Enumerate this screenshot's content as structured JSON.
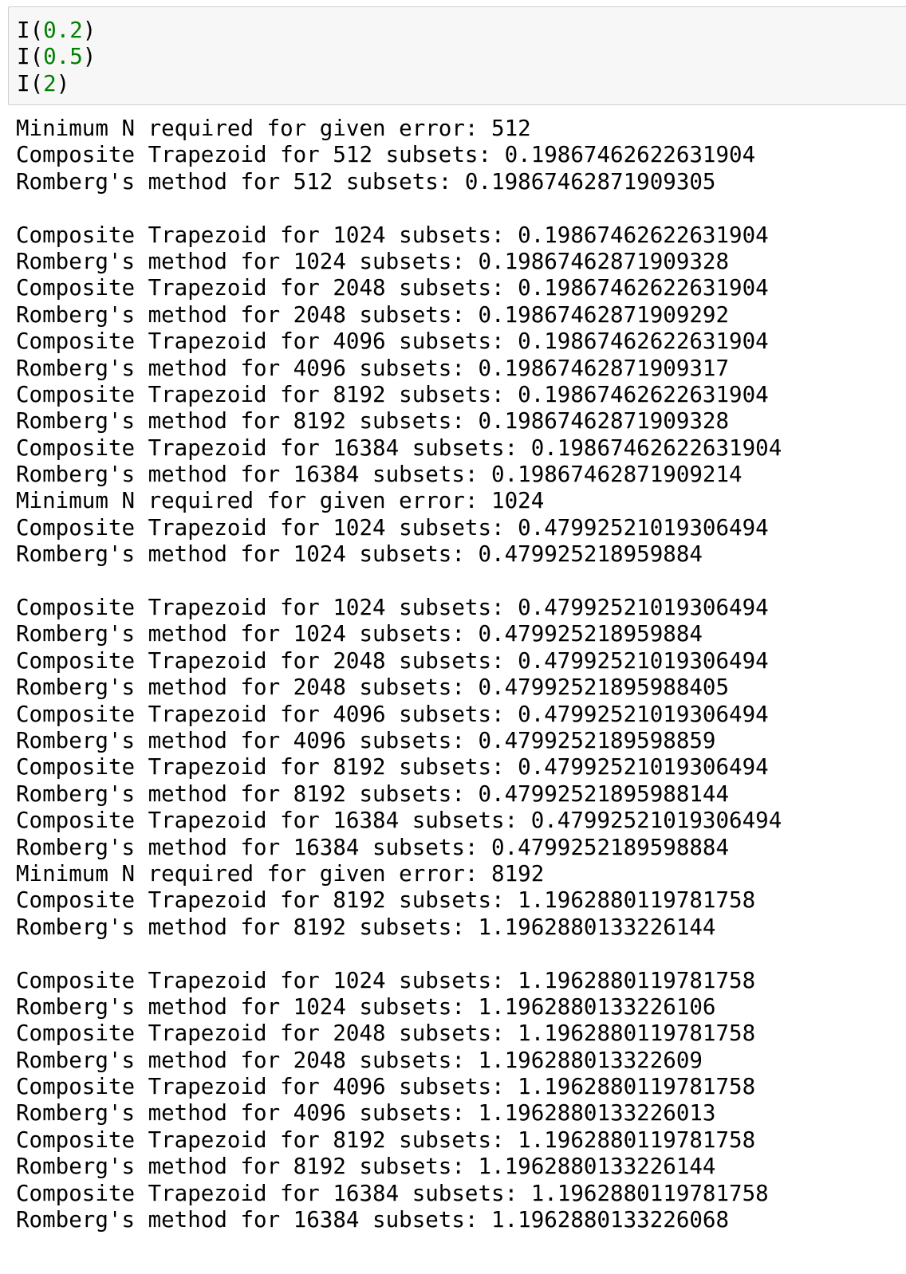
{
  "input_cell": {
    "lines": [
      {
        "func": "I",
        "open": "(",
        "arg": "0.2",
        "close": ")"
      },
      {
        "func": "I",
        "open": "(",
        "arg": "0.5",
        "close": ")"
      },
      {
        "func": "I",
        "open": "(",
        "arg": "2",
        "close": ")"
      }
    ]
  },
  "output": {
    "lines": [
      "Minimum N required for given error: 512",
      "Composite Trapezoid for 512 subsets: 0.19867462622631904",
      "Romberg's method for 512 subsets: 0.19867462871909305",
      "",
      "Composite Trapezoid for 1024 subsets: 0.19867462622631904",
      "Romberg's method for 1024 subsets: 0.19867462871909328",
      "Composite Trapezoid for 2048 subsets: 0.19867462622631904",
      "Romberg's method for 2048 subsets: 0.19867462871909292",
      "Composite Trapezoid for 4096 subsets: 0.19867462622631904",
      "Romberg's method for 4096 subsets: 0.19867462871909317",
      "Composite Trapezoid for 8192 subsets: 0.19867462622631904",
      "Romberg's method for 8192 subsets: 0.19867462871909328",
      "Composite Trapezoid for 16384 subsets: 0.19867462622631904",
      "Romberg's method for 16384 subsets: 0.19867462871909214",
      "Minimum N required for given error: 1024",
      "Composite Trapezoid for 1024 subsets: 0.47992521019306494",
      "Romberg's method for 1024 subsets: 0.479925218959884",
      "",
      "Composite Trapezoid for 1024 subsets: 0.47992521019306494",
      "Romberg's method for 1024 subsets: 0.479925218959884",
      "Composite Trapezoid for 2048 subsets: 0.47992521019306494",
      "Romberg's method for 2048 subsets: 0.47992521895988405",
      "Composite Trapezoid for 4096 subsets: 0.47992521019306494",
      "Romberg's method for 4096 subsets: 0.4799252189598859",
      "Composite Trapezoid for 8192 subsets: 0.47992521019306494",
      "Romberg's method for 8192 subsets: 0.47992521895988144",
      "Composite Trapezoid for 16384 subsets: 0.47992521019306494",
      "Romberg's method for 16384 subsets: 0.4799252189598884",
      "Minimum N required for given error: 8192",
      "Composite Trapezoid for 8192 subsets: 1.1962880119781758",
      "Romberg's method for 8192 subsets: 1.1962880133226144",
      "",
      "Composite Trapezoid for 1024 subsets: 1.1962880119781758",
      "Romberg's method for 1024 subsets: 1.1962880133226106",
      "Composite Trapezoid for 2048 subsets: 1.1962880119781758",
      "Romberg's method for 2048 subsets: 1.196288013322609",
      "Composite Trapezoid for 4096 subsets: 1.1962880119781758",
      "Romberg's method for 4096 subsets: 1.1962880133226013",
      "Composite Trapezoid for 8192 subsets: 1.1962880119781758",
      "Romberg's method for 8192 subsets: 1.1962880133226144",
      "Composite Trapezoid for 16384 subsets: 1.1962880119781758",
      "Romberg's method for 16384 subsets: 1.1962880133226068"
    ]
  },
  "colors": {
    "input_background": "#f7f7f7",
    "input_border": "#cfcfcf",
    "number_literal": "#008000",
    "text": "#000000"
  }
}
